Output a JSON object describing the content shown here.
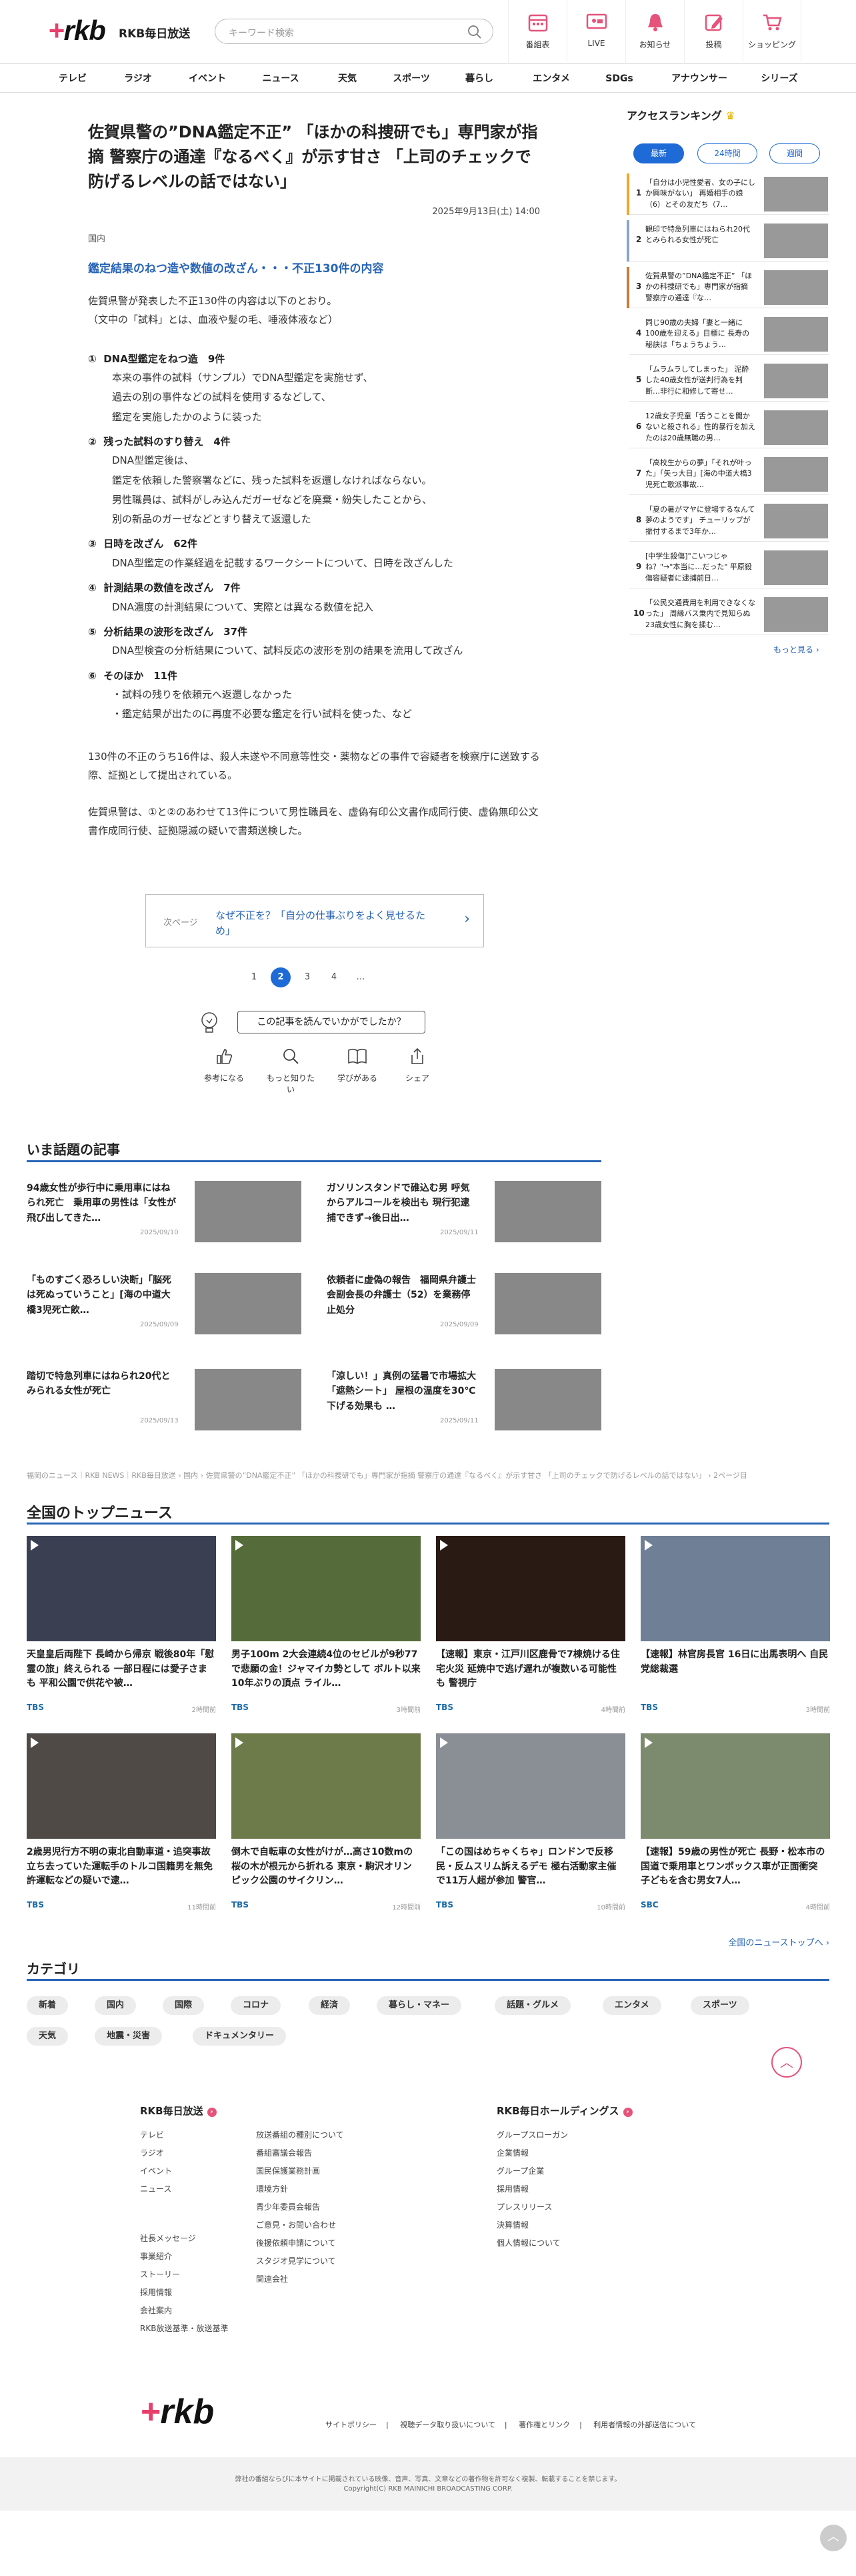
{
  "header": {
    "logo": "rkb",
    "site_name": "RKB毎日放送",
    "search_placeholder": "キーワード検索",
    "nav": [
      {
        "label": "番組表",
        "icon": "calendar-icon"
      },
      {
        "label": "LIVE",
        "icon": "live-tv-icon"
      },
      {
        "label": "お知らせ",
        "icon": "bell-icon"
      },
      {
        "label": "投稿",
        "icon": "pencil-icon"
      },
      {
        "label": "ショッピング",
        "icon": "cart-icon"
      }
    ]
  },
  "genre_nav": [
    "テレビ",
    "ラジオ",
    "イベント",
    "ニュース",
    "天気",
    "スポーツ",
    "暮らし",
    "エンタメ",
    "SDGs",
    "アナウンサー",
    "シリーズ"
  ],
  "article": {
    "title": "佐賀県警の”DNA鑑定不正” 「ほかの科捜研でも」専門家が指摘 警察庁の通達『なるべく』が示す甘さ 「上司のチェックで防げるレベルの話ではない」",
    "date": "2025年9月13日(土) 14:00",
    "category": "国内",
    "subhead": "鑑定結果のねつ造や数値の改ざん・・・不正130件の内容",
    "intro": "佐賀県警が発表した不正130件の内容は以下のとおり。\n（文中の「試料」とは、血液や髪の毛、唾液体液など）",
    "items": [
      {
        "num": "①",
        "head": "DNA型鑑定をねつ造　9件",
        "body": "本来の事件の試料（サンプル）でDNA型鑑定を実施せず、\n過去の別の事件などの試料を使用するなどして、\n鑑定を実施したかのように装った"
      },
      {
        "num": "②",
        "head": "残った試料のすり替え　4件",
        "body": "DNA型鑑定後は、\n鑑定を依頼した警察署などに、残った試料を返還しなければならない。\n男性職員は、試料がしみ込んだガーゼなどを廃棄・紛失したことから、\n別の新品のガーゼなどとすり替えて返還した"
      },
      {
        "num": "③",
        "head": "日時を改ざん　62件",
        "body": "DNA型鑑定の作業経過を記載するワークシートについて、日時を改ざんした"
      },
      {
        "num": "④",
        "head": "計測結果の数値を改ざん　7件",
        "body": "DNA濃度の計測結果について、実際とは異なる数値を記入"
      },
      {
        "num": "⑤",
        "head": "分析結果の波形を改ざん　37件",
        "body": "DNA型検査の分析結果について、試料反応の波形を別の結果を流用して改ざん"
      },
      {
        "num": "⑥",
        "head": "そのほか　11件",
        "body": "・試料の残りを依頼元へ返還しなかった\n・鑑定結果が出たのに再度不必要な鑑定を行い試料を使った、など"
      }
    ],
    "para2": "130件の不正のうち16件は、殺人未遂や不同意等性交・薬物などの事件で容疑者を検察庁に送致する際、証拠として提出されている。",
    "para3": "佐賀県警は、①と②のあわせて13件について男性職員を、虚偽有印公文書作成同行使、虚偽無印公文書作成同行使、証拠隠滅の疑いで書類送検した。",
    "next_label": "次ページ",
    "next_text": "なぜ不正を？「自分の仕事ぶりをよく見せるため」",
    "pages": [
      "1",
      "2",
      "3",
      "4",
      "…"
    ],
    "current_page": "2",
    "feedback_q": "この記事を読んでいかがでしたか？",
    "feedback": [
      {
        "label": "参考になる",
        "icon": "thumbs-up-icon"
      },
      {
        "label": "もっと知りたい",
        "icon": "magnifier-icon"
      },
      {
        "label": "学びがある",
        "icon": "book-icon"
      },
      {
        "label": "シェア",
        "icon": "share-icon"
      }
    ]
  },
  "ranking": {
    "title": "アクセスランキング",
    "tabs": [
      "最新",
      "24時間",
      "週間"
    ],
    "active_tab": "最新",
    "more": "もっと見る ›",
    "items": [
      {
        "num": "1",
        "text": "「自分は小児性愛者、女の子にしか興味がない」 再婚相手の娘（6）とその友だち（7…",
        "color": "#f4a623"
      },
      {
        "num": "2",
        "text": "観印で特急列車にはねられ20代とみられる女性が死亡",
        "color": "#8aa4c8"
      },
      {
        "num": "3",
        "text": "佐賀県警の”DNA鑑定不正” 「ほかの科捜研でも」専門家が指摘 警察庁の通達『な…",
        "color": "#c97b3a"
      },
      {
        "num": "4",
        "text": "同じ90歳の夫婦「妻と一緒に100歳を迎える」目標に 長寿の秘訣は「ちょうちょう…",
        "color": "#fff"
      },
      {
        "num": "5",
        "text": "「ムラムラしてしまった」 泥酔した40歳女性が送判行為を判断…非行に和修して寄せ…",
        "color": "#fff"
      },
      {
        "num": "6",
        "text": "12歳女子児童「舌うことを聞かないと殺される」性的暴行を加えたのは20歳無職の男…",
        "color": "#fff"
      },
      {
        "num": "7",
        "text": "「高校生からの夢」「それが叶った」「矢っ大日」[海の中道大橋3児死亡歌派事故…",
        "color": "#fff"
      },
      {
        "num": "8",
        "text": "「夏の暑がマヤに登場するなんて夢のようです」 チューリップが振付するまで3年か…",
        "color": "#fff"
      },
      {
        "num": "9",
        "text": "[中学生殺傷]\"こいつじゃね？\"→\"本当に…だった\" 平原殺傷容疑者に逮捕前日…",
        "color": "#fff"
      },
      {
        "num": "10",
        "text": "「公民交通費用を利用できなくなった」 周縁バス乗内で見知らぬ23歳女性に胸を揉む…",
        "color": "#fff"
      }
    ]
  },
  "hot": {
    "title": "いま話題の記事",
    "items": [
      {
        "text": "94歳女性が歩行中に乗用車にはねられ死亡　乗用車の男性は「女性が飛び出してきた…",
        "date": "2025/09/10"
      },
      {
        "text": "ガソリンスタンドで碓込む男 呼気からアルコールを検出も 現行犯逮捕できず→後日出…",
        "date": "2025/09/11"
      },
      {
        "text": "「ものすごく恐ろしい決断」「脳死は死ぬっていうこと」[海の中道大橋3児死亡飲…",
        "date": "2025/09/09"
      },
      {
        "text": "依頼者に虚偽の報告　福岡県弁護士会副会長の弁護士（52）を業務停止処分",
        "date": "2025/09/09"
      },
      {
        "text": "踏切で特急列車にはねられ20代とみられる女性が死亡",
        "date": "2025/09/13"
      },
      {
        "text": "「涼しい！」真例の猛暑で市場拡大「遮熱シート」 屋根の温度を30℃下げる効果も …",
        "date": "2025/09/11"
      }
    ]
  },
  "breadcrumb": "福岡のニュース｜RKB NEWS｜RKB毎日放送 › 国内 › 佐賀県警の”DNA鑑定不正” 「ほかの科捜研でも」専門家が指摘 警察庁の通達『なるべく』が示す甘さ 「上司のチェックで防げるレベルの話ではない」 › 2ページ目",
  "top_news": {
    "title": "全国のトップニュース",
    "more": "全国のニューストップへ ›",
    "items": [
      {
        "text": "天皇皇后両陛下 長崎から帰京 戦後80年「慰霊の旅」終えられる 一部日程には愛子さまも 平和公園で供花や被…",
        "src": "TBS",
        "date": "2時間前",
        "color": "#3a3f52"
      },
      {
        "text": "男子100m 2大会連続4位のセビルが9秒77で悲願の金！ジャマイカ勢として ボルト以来10年ぶりの頂点 ライル…",
        "src": "TBS",
        "date": "3時間前",
        "color": "#556b3a"
      },
      {
        "text": "【速報】東京・江戸川区鹿骨で7棟焼ける住宅火災 延焼中で逃げ遅れが複数いる可能性も 警視庁",
        "src": "TBS",
        "date": "4時間前",
        "color": "#2a1a14"
      },
      {
        "text": "【速報】林官房長官 16日に出馬表明へ 自民党総裁選",
        "src": "TBS",
        "date": "3時間前",
        "color": "#6e7f96"
      },
      {
        "text": "2歳男児行方不明の東北自動車道・追突事故 立ち去っていた運転手のトルコ国籍男を無免許運転などの疑いで逮…",
        "src": "TBS",
        "date": "11時間前",
        "color": "#4f4a46"
      },
      {
        "text": "倒木で自転車の女性がけが…高さ10数mの桜の木が根元から折れる 東京・駒沢オリンピック公園のサイクリン…",
        "src": "TBS",
        "date": "12時間前",
        "color": "#6d7a4a"
      },
      {
        "text": "「この国はめちゃくちゃ」ロンドンで反移民・反ムスリム訴えるデモ 極右活動家主催で11万人超が参加 警官…",
        "src": "TBS",
        "date": "10時間前",
        "color": "#8a8f96"
      },
      {
        "text": "【速報】59歳の男性が死亡 長野・松本市の国道で乗用車とワンボックス車が正面衝突 子どもを含む男女7人…",
        "src": "SBC",
        "date": "4時間前",
        "color": "#7c8a6e"
      }
    ]
  },
  "categories": {
    "title": "カテゴリ",
    "chips": [
      "新着",
      "国内",
      "国際",
      "コロナ",
      "経済",
      "暮らし・マネー",
      "話題・グルメ",
      "エンタメ",
      "スポーツ",
      "天気",
      "地震・災害",
      "ドキュメンタリー"
    ]
  },
  "footer": {
    "col1_title": "RKB毎日放送",
    "col1a": [
      "テレビ",
      "ラジオ",
      "イベント",
      "ニュース"
    ],
    "col1b": [
      "放送番組の種別について",
      "番組審議会報告",
      "国民保護業務計画",
      "環境方針",
      "青少年委員会報告",
      "ご意見・お問い合わせ",
      "後援依頼申請について",
      "スタジオ見学について",
      "関連会社"
    ],
    "col1c": [
      "社長メッセージ",
      "事業紹介",
      "ストーリー",
      "採用情報",
      "会社案内",
      "RKB放送基準・放送基準"
    ],
    "col2_title": "RKB毎日ホールディングス",
    "col2": [
      "グループスローガン",
      "企業情報",
      "グループ企業",
      "採用情報",
      "プレスリリース",
      "決算情報",
      "個人情報について"
    ],
    "links": [
      "サイトポリシー",
      "視聴データ取り扱いについて",
      "著作権とリンク",
      "利用者情報の外部送信について"
    ],
    "notice": "弊社の番組ならびに本サイトに掲載されている映像、音声、写真、文章などの著作物を許可なく複製、転載することを禁じます。",
    "copyright": "Copyright(C) RKB MAINICHI BROADCASTING CORP."
  }
}
